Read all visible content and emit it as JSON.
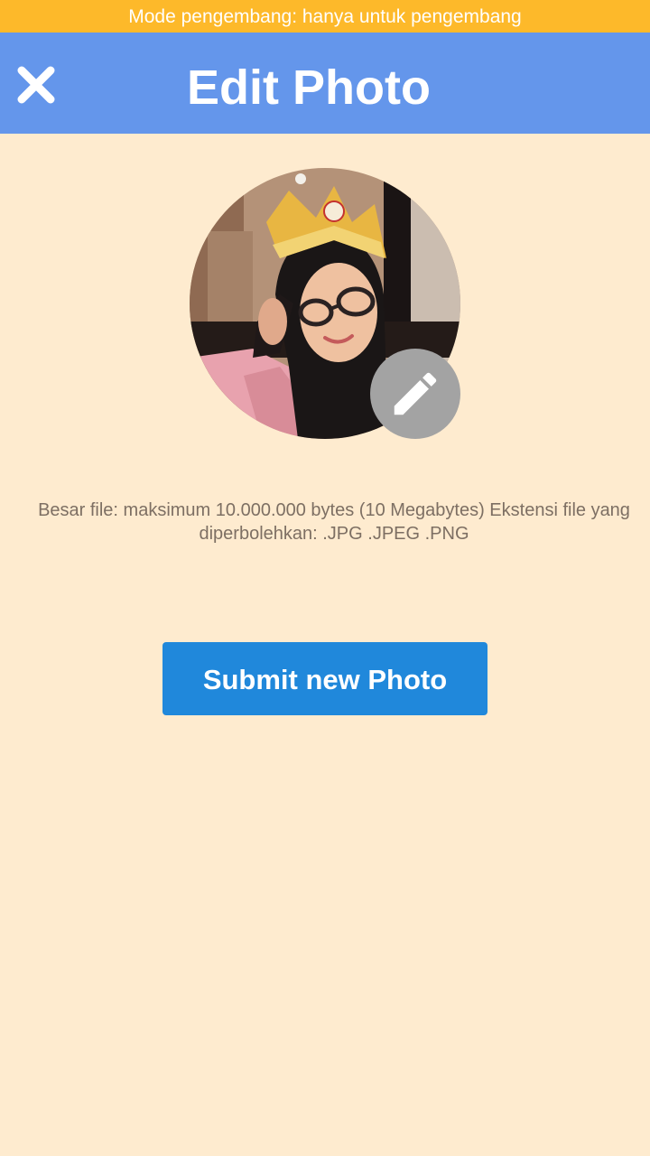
{
  "dev_banner": {
    "text": "Mode pengembang: hanya untuk pengembang",
    "color": "#fdb92a"
  },
  "header": {
    "title": "Edit Photo",
    "close_icon": "close-icon",
    "color": "#6496eb"
  },
  "profile": {
    "edit_icon": "pencil-icon"
  },
  "file_info": {
    "text": "Besar file: maksimum 10.000.000 bytes (10 Megabytes) Ekstensi file yang diperbolehkan: .JPG .JPEG .PNG"
  },
  "submit": {
    "label": "Submit new Photo",
    "color": "#2088db"
  },
  "background_color": "#feebcf"
}
